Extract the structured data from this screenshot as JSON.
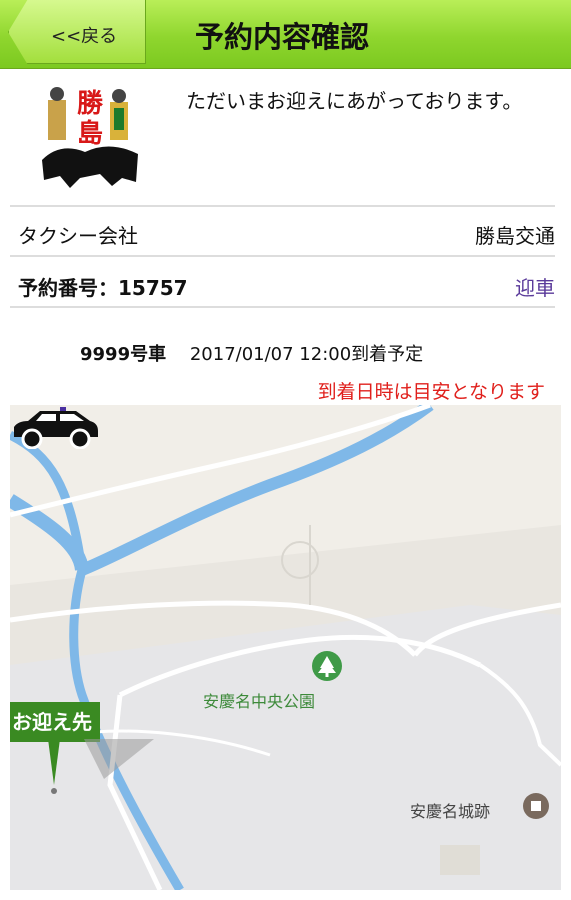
{
  "header": {
    "back_label": "<<戻る",
    "title": "予約内容確認"
  },
  "notice": {
    "message": "ただいまお迎えにあがっております。"
  },
  "logo": {
    "text": "勝島"
  },
  "details": {
    "company_label": "タクシー会社",
    "company_value": "勝島交通",
    "reservation_label": "予約番号：15757",
    "reservation_status": "迎車"
  },
  "arrival": {
    "car_number": "9999号車",
    "eta": "2017/01/07 12:00到着予定",
    "warning": "到着日時は目安となります"
  },
  "map": {
    "park_label": "安慶名中央公園",
    "castle_label": "安慶名城跡",
    "pickup_label": "お迎え先",
    "water_color": "#7fb8e8",
    "green_color": "#3a8a22"
  }
}
